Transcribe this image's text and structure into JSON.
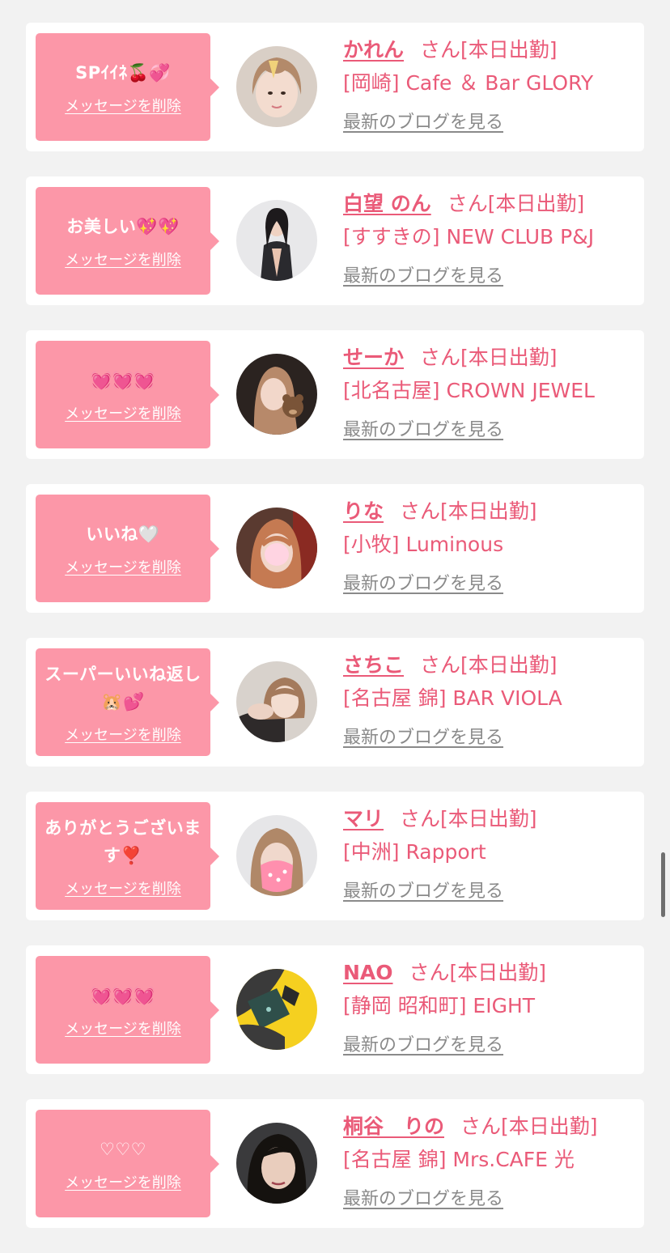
{
  "common": {
    "delete_label": "メッセージを削除",
    "san_label": "さん[本日出勤]",
    "blog_label": "最新のブログを見る"
  },
  "colors": {
    "background": "#f2f2f2",
    "bubble": "#fc97a8",
    "name": "#ea5a78",
    "blog_link": "#8a8a8a"
  },
  "cards": [
    {
      "message": "SPｲｲﾈ🍒💞",
      "name": "かれん",
      "store": "[岡崎] Cafe ＆ Bar GLORY",
      "avatar": "light-hair-woman"
    },
    {
      "message": "お美しい💖💖",
      "name": "白望 のん",
      "store": "[すすきの] NEW CLUB P&J",
      "avatar": "dark-hair-woman-black-dress"
    },
    {
      "message": "💓💓💓",
      "name": "せーか",
      "store": "[北名古屋] CROWN JEWEL",
      "avatar": "woman-with-teddy-bear"
    },
    {
      "message": "いいね🤍",
      "name": "りな",
      "store": "[小牧] Luminous",
      "avatar": "woman-blurred-face"
    },
    {
      "message": "スーパーいいね返し🐹💕",
      "name": "さちこ",
      "store": "[名古屋 錦] BAR VIOLA",
      "avatar": "woman-leaning"
    },
    {
      "message": "ありがとうございます❣️",
      "name": "マリ",
      "store": "[中洲] Rapport",
      "avatar": "woman-face-covered-pink"
    },
    {
      "message": "💓💓💓",
      "name": "NAO",
      "store": "[静岡 昭和町] EIGHT",
      "avatar": "eight-logo-yellow"
    },
    {
      "message": "♡♡♡",
      "name": "桐谷　りの",
      "store": "[名古屋 錦] Mrs.CAFE 光",
      "avatar": "woman-dark-hair-selfie"
    }
  ]
}
